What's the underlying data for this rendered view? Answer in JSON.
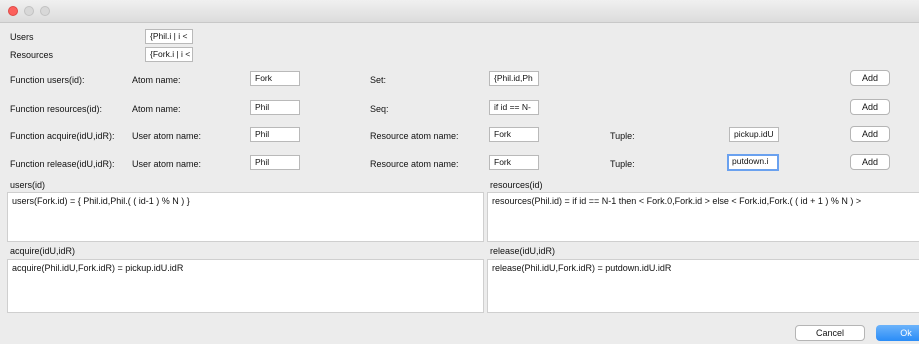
{
  "top": {
    "users_label": "Users",
    "users_value": "{Phil.i | i <",
    "resources_label": "Resources",
    "resources_value": "{Fork.i | i <"
  },
  "rows": [
    {
      "fn_label": "Function users(id):",
      "atom_label": "Atom name:",
      "atom_value": "Fork",
      "mid_label": "Set:",
      "mid_value": "{Phil.id,Ph",
      "add": "Add"
    },
    {
      "fn_label": "Function resources(id):",
      "atom_label": "Atom name:",
      "atom_value": "Phil",
      "mid_label": "Seq:",
      "mid_value": "if id == N-",
      "add": "Add"
    },
    {
      "fn_label": "Function acquire(idU,idR):",
      "atom_label": "User atom name:",
      "atom_value": "Phil",
      "mid_label": "Resource atom name:",
      "mid_value": "Fork",
      "tuple_label": "Tuple:",
      "tuple_value": "pickup.idU",
      "add": "Add"
    },
    {
      "fn_label": "Function release(idU,idR):",
      "atom_label": "User atom name:",
      "atom_value": "Phil",
      "mid_label": "Resource atom name:",
      "mid_value": "Fork",
      "tuple_label": "Tuple:",
      "tuple_value": "putdown.i",
      "add": "Add"
    }
  ],
  "panes": {
    "users": {
      "title": "users(id)",
      "text": "users(Fork.id) = { Phil.id,Phil.( ( id-1 ) % N )  }"
    },
    "resources": {
      "title": "resources(id)",
      "text": "resources(Phil.id) = if id == N-1 then < Fork.0,Fork.id > else < Fork.id,Fork.( ( id + 1 ) % N ) >"
    },
    "acquire": {
      "title": "acquire(idU,idR)",
      "text": "acquire(Phil.idU,Fork.idR) = pickup.idU.idR"
    },
    "release": {
      "title": "release(idU,idR)",
      "text": "release(Phil.idU,Fork.idR) = putdown.idU.idR"
    }
  },
  "footer": {
    "cancel": "Cancel",
    "ok": "Ok"
  }
}
